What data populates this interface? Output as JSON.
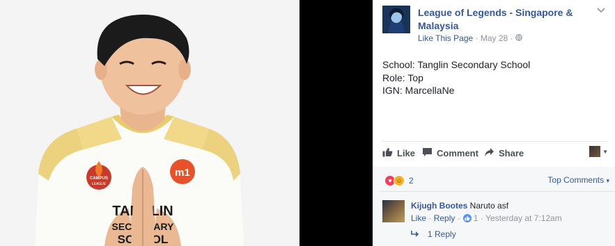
{
  "post": {
    "page_name": "League of Legends - Singapore & Malaysia",
    "like_page": "Like This Page",
    "date": "May 28",
    "separator": " · ",
    "lines": [
      "School: Tanglin Secondary School",
      "Role: Top",
      "IGN: MarcellaNe"
    ]
  },
  "photo": {
    "jersey_logo": "m1",
    "jersey_text_1": "TANGLIN",
    "jersey_text_2": "SECONDARY",
    "jersey_text_3": "SCHOOL",
    "badge_text_1": "CAMPUS",
    "badge_text_2": "LEAGUE"
  },
  "actions": {
    "like": "Like",
    "comment": "Comment",
    "share": "Share"
  },
  "reactions": {
    "count": "2",
    "sort_label": "Top Comments"
  },
  "comment": {
    "author": "Kijugh Bootes",
    "text": "Naruto asf",
    "like": "Like",
    "reply": "Reply",
    "like_count": "1",
    "time": "Yesterday at 7:12am",
    "replies": "1 Reply"
  },
  "icons": {
    "globe": "globe-icon",
    "chevron": "chevron-down-icon",
    "thumb": "thumbs-up-icon",
    "comment": "comment-bubble-icon",
    "share": "share-arrow-icon",
    "love": "love-reaction-icon",
    "haha": "haha-reaction-icon",
    "reply_arrow": "reply-arrow-icon"
  },
  "colors": {
    "link": "#365899",
    "meta": "#90949c",
    "love": "#f33e58",
    "haha": "#f7b125",
    "like_badge": "#5890ff"
  }
}
